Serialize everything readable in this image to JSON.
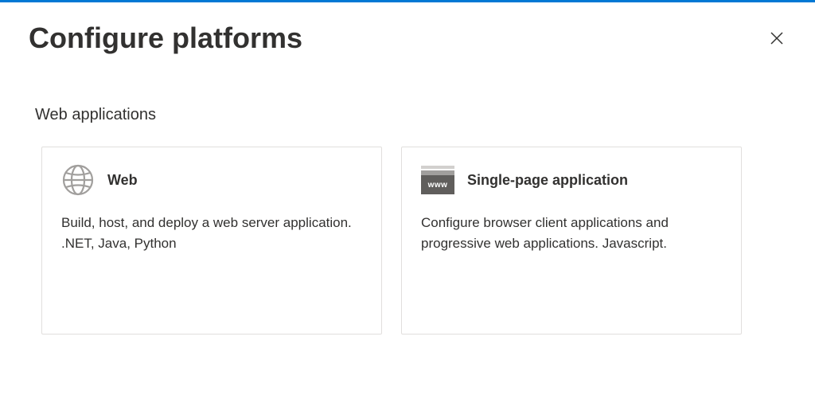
{
  "header": {
    "title": "Configure platforms"
  },
  "section": {
    "title": "Web applications"
  },
  "cards": {
    "web": {
      "title": "Web",
      "description": "Build, host, and deploy a web server application. .NET, Java, Python"
    },
    "spa": {
      "title": "Single-page application",
      "description": "Configure browser client applications and progressive web applications. Javascript.",
      "iconText": "www"
    }
  }
}
